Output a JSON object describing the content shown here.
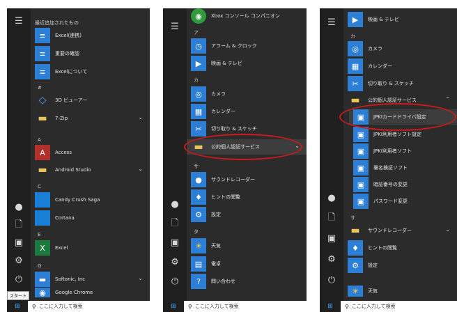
{
  "panel1": {
    "section_header": "最近追加されたもの",
    "rows": [
      {
        "label": "Excel(連携)",
        "icon": "app-icon",
        "color": "#2d7fd6",
        "glyph": "≡"
      },
      {
        "label": "重要の確認",
        "icon": "app-icon",
        "color": "#2d7fd6",
        "glyph": "≡"
      },
      {
        "label": "Excelについて",
        "icon": "app-icon",
        "color": "#2d7fd6",
        "glyph": "≡"
      },
      {
        "label": "3D ビューアー",
        "icon": "cube-icon",
        "color": "#2d7fd6",
        "glyph": "◇"
      },
      {
        "label": "7-Zip",
        "icon": "folder-icon",
        "color": "#e8c45c",
        "glyph": "▬"
      },
      {
        "label": "Access",
        "icon": "access-icon",
        "color": "#b0302c",
        "glyph": "A"
      },
      {
        "label": "Android Studio",
        "icon": "folder-icon",
        "color": "#e8c45c",
        "glyph": "▬"
      },
      {
        "label": "Candy Crush Saga",
        "icon": "app-icon",
        "color": "#1a7fd6",
        "glyph": ""
      },
      {
        "label": "Cortana",
        "icon": "app-icon",
        "color": "#1a7fd6",
        "glyph": ""
      },
      {
        "label": "Excel",
        "icon": "excel-icon",
        "color": "#1d7a3e",
        "glyph": "X"
      },
      {
        "label": "Softonic, Inc",
        "icon": "folder-icon",
        "color": "#2d7fd6",
        "glyph": "▬"
      },
      {
        "label": "Google Chrome",
        "icon": "chrome-icon",
        "color": "#2d7fd6",
        "glyph": "◉"
      }
    ],
    "letters": [
      "#",
      "A",
      "C",
      "E",
      "G"
    ],
    "tooltip": "スタート"
  },
  "panel2": {
    "rows": [
      {
        "label": "Xbox コンソール コンパニオン",
        "icon": "xbox-icon",
        "color": "#2f9b3a",
        "glyph": "◉"
      },
      {
        "label": "アラーム & クロック",
        "icon": "alarm-icon",
        "color": "#2d7fd6",
        "glyph": "◷"
      },
      {
        "label": "映画 & テレビ",
        "icon": "movie-icon",
        "color": "#2d7fd6",
        "glyph": "▶"
      },
      {
        "label": "カメラ",
        "icon": "camera-icon",
        "color": "#2d7fd6",
        "glyph": "◎"
      },
      {
        "label": "カレンダー",
        "icon": "calendar-icon",
        "color": "#2d7fd6",
        "glyph": "▦"
      },
      {
        "label": "切り取り & スケッチ",
        "icon": "snip-icon",
        "color": "#2d7fd6",
        "glyph": "✂"
      },
      {
        "label": "公的個人認証サービス",
        "icon": "folder-icon",
        "color": "#e8c45c",
        "glyph": "▬"
      },
      {
        "label": "サウンドレコーダー",
        "icon": "recorder-icon",
        "color": "#2d7fd6",
        "glyph": "●"
      },
      {
        "label": "ヒントの閲覧",
        "icon": "tips-icon",
        "color": "#2d7fd6",
        "glyph": "♦"
      },
      {
        "label": "設定",
        "icon": "gear-icon",
        "color": "#2d7fd6",
        "glyph": "⚙"
      },
      {
        "label": "天気",
        "icon": "weather-icon",
        "color": "#2d7fd6",
        "glyph": "☀"
      },
      {
        "label": "電卓",
        "icon": "calculator-icon",
        "color": "#2d7fd6",
        "glyph": "▤"
      },
      {
        "label": "問い合わせ",
        "icon": "help-icon",
        "color": "#2d7fd6",
        "glyph": "?"
      }
    ],
    "letters": [
      "ア",
      "カ",
      "サ",
      "タ"
    ]
  },
  "panel3": {
    "rows": [
      {
        "label": "映画 & テレビ",
        "icon": "movie-icon",
        "color": "#2d7fd6",
        "glyph": "▶"
      },
      {
        "label": "カメラ",
        "icon": "camera-icon",
        "color": "#2d7fd6",
        "glyph": "◎"
      },
      {
        "label": "カレンダー",
        "icon": "calendar-icon",
        "color": "#2d7fd6",
        "glyph": "▦"
      },
      {
        "label": "切り取り & スケッチ",
        "icon": "snip-icon",
        "color": "#2d7fd6",
        "glyph": "✂"
      },
      {
        "label": "公的個人認証サービス",
        "icon": "folder-icon",
        "color": "#e8c45c",
        "glyph": "▬"
      },
      {
        "label": "JPKIカードドライバ設定",
        "icon": "jpki-icon",
        "color": "#2d7fd6",
        "glyph": "▣"
      },
      {
        "label": "JPKI利用者ソフト設定",
        "icon": "jpki-icon",
        "color": "#2d7fd6",
        "glyph": "▣"
      },
      {
        "label": "JPKI利用者ソフト",
        "icon": "jpki-icon",
        "color": "#2d7fd6",
        "glyph": "▣"
      },
      {
        "label": "署名検証ソフト",
        "icon": "jpki-icon",
        "color": "#2d7fd6",
        "glyph": "▣"
      },
      {
        "label": "暗証番号の変更",
        "icon": "jpki-icon",
        "color": "#2d7fd6",
        "glyph": "▣"
      },
      {
        "label": "パスワード変更",
        "icon": "jpki-icon",
        "color": "#2d7fd6",
        "glyph": "▣"
      },
      {
        "label": "サウンドレコーダー",
        "icon": "folder-icon",
        "color": "#e8c45c",
        "glyph": "▬"
      },
      {
        "label": "ヒントの閲覧",
        "icon": "tips-icon",
        "color": "#2d7fd6",
        "glyph": "♦"
      },
      {
        "label": "設定",
        "icon": "gear-icon",
        "color": "#2d7fd6",
        "glyph": "⚙"
      },
      {
        "label": "天気",
        "icon": "weather-icon",
        "color": "#2d7fd6",
        "glyph": "☀"
      }
    ],
    "letters": [
      "カ",
      "サ"
    ]
  },
  "taskbar": {
    "search_placeholder": "ここに入力して検索"
  }
}
